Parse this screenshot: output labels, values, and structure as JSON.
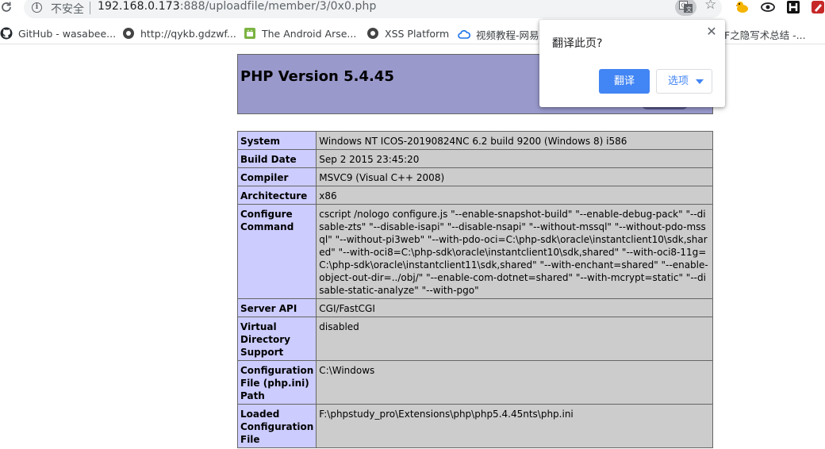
{
  "browser": {
    "reload_icon": "reload-icon",
    "security_label": "不安全",
    "url_host": "192.168.0.173",
    "url_rest": ":888/uploadfile/member/3/0x0.php",
    "bookmarks": [
      {
        "label": "GitHub - wasabee...",
        "icon": "github-icon"
      },
      {
        "label": "http://qykb.gdzwf...",
        "icon": "globe-icon"
      },
      {
        "label": "The Android Arse...",
        "icon": "android-icon"
      },
      {
        "label": "XSS Platform",
        "icon": "globe-icon"
      },
      {
        "label": "视频教程-网易",
        "icon": "cloud-icon"
      },
      {
        "label": "F之隐写术总结 -...",
        "icon": "bookmark-icon"
      }
    ]
  },
  "translate_popup": {
    "title": "翻译此页?",
    "translate_label": "翻译",
    "options_label": "选项",
    "accent": "#4285f4"
  },
  "phpinfo": {
    "title": "PHP Version 5.4.45",
    "header_color": "#9999cc",
    "rows": [
      {
        "key": "System",
        "value": "Windows NT ICOS-20190824NC 6.2 build 9200 (Windows 8) i586"
      },
      {
        "key": "Build Date",
        "value": "Sep 2 2015 23:45:20"
      },
      {
        "key": "Compiler",
        "value": "MSVC9 (Visual C++ 2008)"
      },
      {
        "key": "Architecture",
        "value": "x86"
      },
      {
        "key": "Configure Command",
        "value": "cscript /nologo configure.js \"--enable-snapshot-build\" \"--enable-debug-pack\" \"--disable-zts\" \"--disable-isapi\" \"--disable-nsapi\" \"--without-mssql\" \"--without-pdo-mssql\" \"--without-pi3web\" \"--with-pdo-oci=C:\\php-sdk\\oracle\\instantclient10\\sdk,shared\" \"--with-oci8=C:\\php-sdk\\oracle\\instantclient10\\sdk,shared\" \"--with-oci8-11g=C:\\php-sdk\\oracle\\instantclient11\\sdk,shared\" \"--with-enchant=shared\" \"--enable-object-out-dir=../obj/\" \"--enable-com-dotnet=shared\" \"--with-mcrypt=static\" \"--disable-static-analyze\" \"--with-pgo\""
      },
      {
        "key": "Server API",
        "value": "CGI/FastCGI"
      },
      {
        "key": "Virtual Directory Support",
        "value": "disabled"
      },
      {
        "key": "Configuration File (php.ini) Path",
        "value": "C:\\Windows"
      },
      {
        "key": "Loaded Configuration File",
        "value": "F:\\phpstudy_pro\\Extensions\\php\\php5.4.45nts\\php.ini"
      }
    ]
  }
}
